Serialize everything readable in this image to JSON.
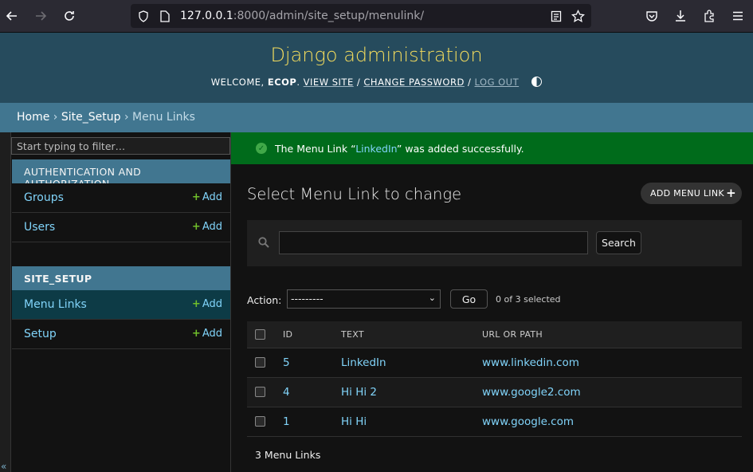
{
  "browser": {
    "url_host": "127.0.0.1",
    "url_rest": ":8000/admin/site_setup/menulink/",
    "icons": [
      "back-arrow-icon",
      "forward-arrow-icon",
      "reload-icon",
      "shield-icon",
      "page-icon",
      "reader-view-icon",
      "star-icon",
      "pocket-icon",
      "download-icon",
      "extensions-icon",
      "menu-icon"
    ]
  },
  "header": {
    "title": "Django administration",
    "welcome": "WELCOME,",
    "user": "ECOP",
    "view_site": "VIEW SITE",
    "change_password": "CHANGE PASSWORD",
    "log_out": "LOG OUT",
    "sep": "/"
  },
  "breadcrumbs": {
    "home": "Home",
    "app": "Site_Setup",
    "current": "Menu Links",
    "sep": "›"
  },
  "sidebar": {
    "filter_placeholder": "Start typing to filter…",
    "toggle": "«",
    "modules": [
      {
        "caption": "AUTHENTICATION AND AUTHORIZATION",
        "items": [
          {
            "name": "Groups",
            "add": "Add"
          },
          {
            "name": "Users",
            "add": "Add"
          }
        ]
      },
      {
        "caption": "SITE_SETUP",
        "items": [
          {
            "name": "Menu Links",
            "add": "Add"
          },
          {
            "name": "Setup",
            "add": "Add"
          }
        ]
      }
    ]
  },
  "message": {
    "before": "The Menu Link “",
    "link": "LinkedIn",
    "after": "” was added successfully."
  },
  "main": {
    "title": "Select Menu Link to change",
    "add_button": "ADD MENU LINK",
    "search_button": "Search",
    "action_label": "Action:",
    "action_value": "---------",
    "go_button": "Go",
    "selected": "0 of 3 selected",
    "columns": [
      "ID",
      "TEXT",
      "URL OR PATH"
    ],
    "rows": [
      {
        "id": "5",
        "text": "LinkedIn",
        "url": "www.linkedin.com"
      },
      {
        "id": "4",
        "text": "Hi Hi 2",
        "url": "www.google2.com"
      },
      {
        "id": "1",
        "text": "Hi Hi",
        "url": "www.google.com"
      }
    ],
    "paginator": "3 Menu Links"
  },
  "colors": {
    "header": "#264b5d",
    "breadcrumbs": "#417690",
    "success": "#006b1b",
    "link": "#81d4fa",
    "branding": "#f5dd5d",
    "add_green": "#70bf2b"
  }
}
